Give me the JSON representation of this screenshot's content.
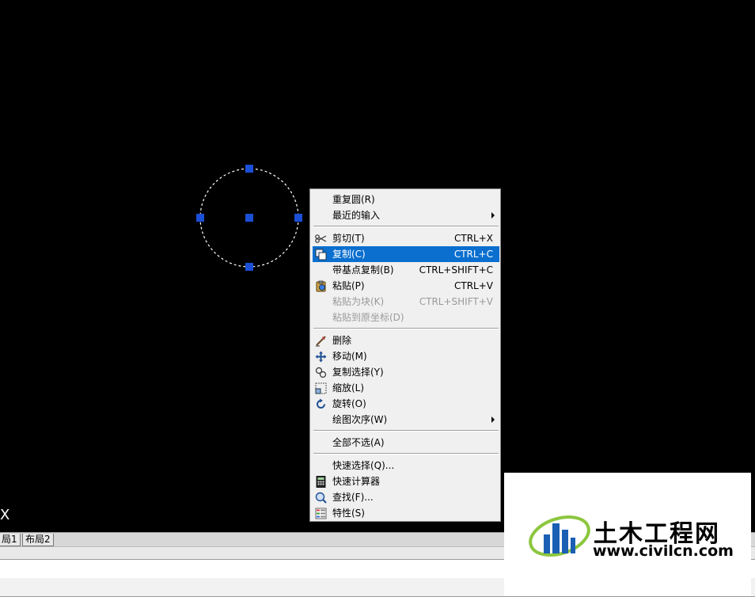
{
  "canvas": {
    "background": "#000000",
    "ucs_label": "X"
  },
  "tabs": [
    "局1",
    "布局2"
  ],
  "context_menu": {
    "items": [
      {
        "id": "repeat-circle",
        "label": "重复圆(R)",
        "shortcut": "",
        "submenu": false,
        "disabled": false,
        "icon": ""
      },
      {
        "id": "recent-input",
        "label": "最近的输入",
        "shortcut": "",
        "submenu": true,
        "disabled": false,
        "icon": ""
      },
      {
        "id": "cut",
        "label": "剪切(T)",
        "shortcut": "CTRL+X",
        "submenu": false,
        "disabled": false,
        "icon": "scissors-icon"
      },
      {
        "id": "copy",
        "label": "复制(C)",
        "shortcut": "CTRL+C",
        "submenu": false,
        "disabled": false,
        "icon": "copy-icon",
        "highlighted": true
      },
      {
        "id": "copy-with-base",
        "label": "带基点复制(B)",
        "shortcut": "CTRL+SHIFT+C",
        "submenu": false,
        "disabled": false,
        "icon": ""
      },
      {
        "id": "paste",
        "label": "粘贴(P)",
        "shortcut": "CTRL+V",
        "submenu": false,
        "disabled": false,
        "icon": "paste-icon"
      },
      {
        "id": "paste-as-block",
        "label": "粘贴为块(K)",
        "shortcut": "CTRL+SHIFT+V",
        "submenu": false,
        "disabled": true,
        "icon": ""
      },
      {
        "id": "paste-orig-coords",
        "label": "粘贴到原坐标(D)",
        "shortcut": "",
        "submenu": false,
        "disabled": true,
        "icon": ""
      },
      {
        "id": "erase",
        "label": "删除",
        "shortcut": "",
        "submenu": false,
        "disabled": false,
        "icon": "eraser-icon"
      },
      {
        "id": "move",
        "label": "移动(M)",
        "shortcut": "",
        "submenu": false,
        "disabled": false,
        "icon": "move-icon"
      },
      {
        "id": "copy-selection",
        "label": "复制选择(Y)",
        "shortcut": "",
        "submenu": false,
        "disabled": false,
        "icon": "copy-selection-icon"
      },
      {
        "id": "scale",
        "label": "缩放(L)",
        "shortcut": "",
        "submenu": false,
        "disabled": false,
        "icon": "scale-icon"
      },
      {
        "id": "rotate",
        "label": "旋转(O)",
        "shortcut": "",
        "submenu": false,
        "disabled": false,
        "icon": "rotate-icon"
      },
      {
        "id": "draw-order",
        "label": "绘图次序(W)",
        "shortcut": "",
        "submenu": true,
        "disabled": false,
        "icon": ""
      },
      {
        "id": "deselect-all",
        "label": "全部不选(A)",
        "shortcut": "",
        "submenu": false,
        "disabled": false,
        "icon": ""
      },
      {
        "id": "quick-select",
        "label": "快速选择(Q)...",
        "shortcut": "",
        "submenu": false,
        "disabled": false,
        "icon": ""
      },
      {
        "id": "quick-calc",
        "label": "快速计算器",
        "shortcut": "",
        "submenu": false,
        "disabled": false,
        "icon": "calculator-icon"
      },
      {
        "id": "find",
        "label": "查找(F)...",
        "shortcut": "",
        "submenu": false,
        "disabled": false,
        "icon": "find-icon"
      },
      {
        "id": "properties",
        "label": "特性(S)",
        "shortcut": "",
        "submenu": false,
        "disabled": false,
        "icon": "properties-icon"
      }
    ],
    "highlight_color": "#0a6fcf"
  },
  "watermark": {
    "title": "土木工程网",
    "url": "www.civilcn.com"
  },
  "colors": {
    "grip": "#1a4fd6",
    "circle": "#ffffff"
  }
}
